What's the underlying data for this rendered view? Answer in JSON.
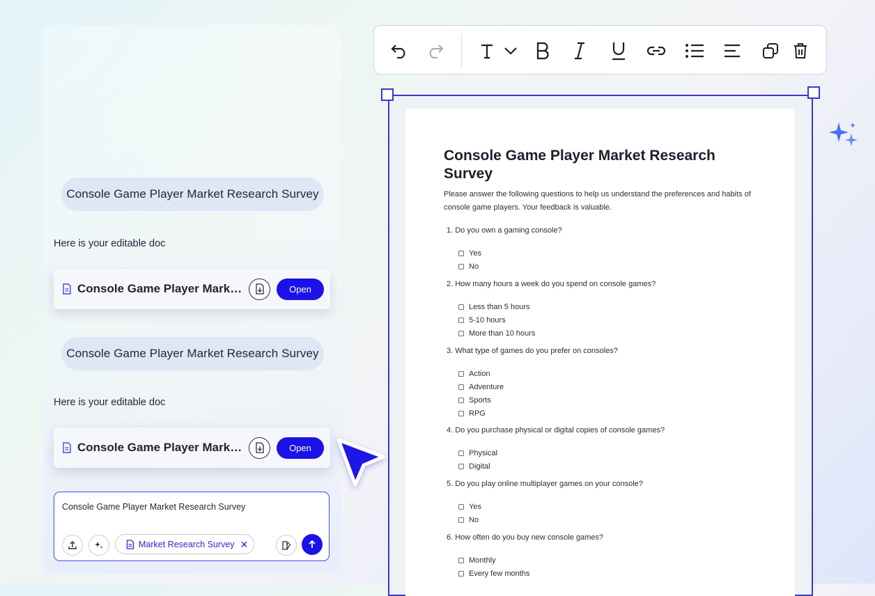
{
  "chat": {
    "messages": [
      {
        "prompt": "Console Game Player Market Research Survey",
        "reply": "Here is your editable doc",
        "doc_title": "Console Game Player Market Research Survey",
        "open_label": "Open"
      },
      {
        "prompt": "Console Game Player Market Research Survey",
        "reply": "Here is your editable doc",
        "doc_title": "Console Game Player Market Research Survey",
        "open_label": "Open"
      }
    ],
    "composer": {
      "text": "Console Game Player Market Research Survey",
      "attachment_label": "Market Research Survey"
    }
  },
  "toolbar": {
    "icons": [
      "undo-icon",
      "redo-icon",
      "text-style-icon",
      "chevron-down-icon",
      "bold-icon",
      "italic-icon",
      "underline-icon",
      "link-icon",
      "bullet-list-icon",
      "align-left-icon",
      "duplicate-icon",
      "delete-icon"
    ]
  },
  "document": {
    "title": "Console Game Player Market Research Survey",
    "intro": "Please answer the following questions to help us understand the preferences and habits of console game players. Your feedback is valuable.",
    "questions": [
      {
        "text": "1. Do you own a gaming console?",
        "options": [
          "Yes",
          "No"
        ]
      },
      {
        "text": "2. How many hours a week do you spend on console games?",
        "options": [
          "Less than 5 hours",
          "5-10 hours",
          "More than 10 hours"
        ]
      },
      {
        "text": "3. What type of games do you prefer on consoles?",
        "options": [
          "Action",
          "Adventure",
          "Sports",
          "RPG"
        ]
      },
      {
        "text": "4. Do you purchase physical or digital copies of console games?",
        "options": [
          "Physical",
          "Digital"
        ]
      },
      {
        "text": "5. Do you play online multiplayer games on your console?",
        "options": [
          "Yes",
          "No"
        ]
      },
      {
        "text": "6. How often do you buy new console games?",
        "options": [
          "Monthly",
          "Every few months"
        ]
      }
    ]
  },
  "colors": {
    "accent": "#1a12e6",
    "selection": "#3a34d6",
    "bubble": "#dde7f5"
  }
}
